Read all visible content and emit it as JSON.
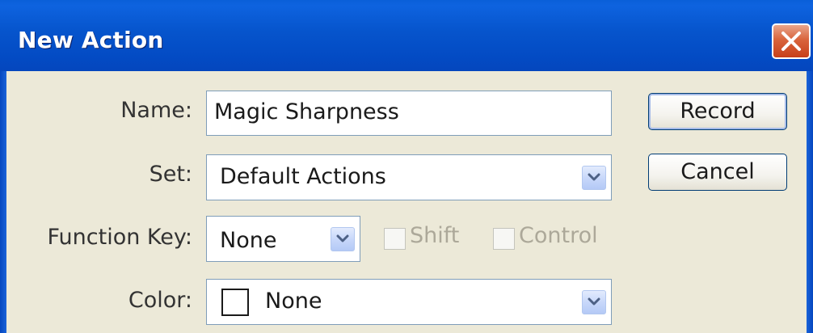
{
  "window": {
    "title": "New Action"
  },
  "form": {
    "name_label": "Name:",
    "name_value": "Magic Sharpness",
    "set_label": "Set:",
    "set_value": "Default Actions",
    "function_key_label": "Function Key:",
    "function_key_value": "None",
    "shift_label": "Shift",
    "control_label": "Control",
    "color_label": "Color:",
    "color_value": "None"
  },
  "buttons": {
    "record_label": "Record",
    "cancel_label": "Cancel"
  },
  "icons": {
    "close": "close-icon",
    "dropdown": "chevron-down-icon"
  },
  "colors": {
    "titlebar": "#0654cc",
    "dialog_bg": "#ece9d8",
    "close_button": "#d9643c",
    "disabled_text": "#aca899"
  }
}
